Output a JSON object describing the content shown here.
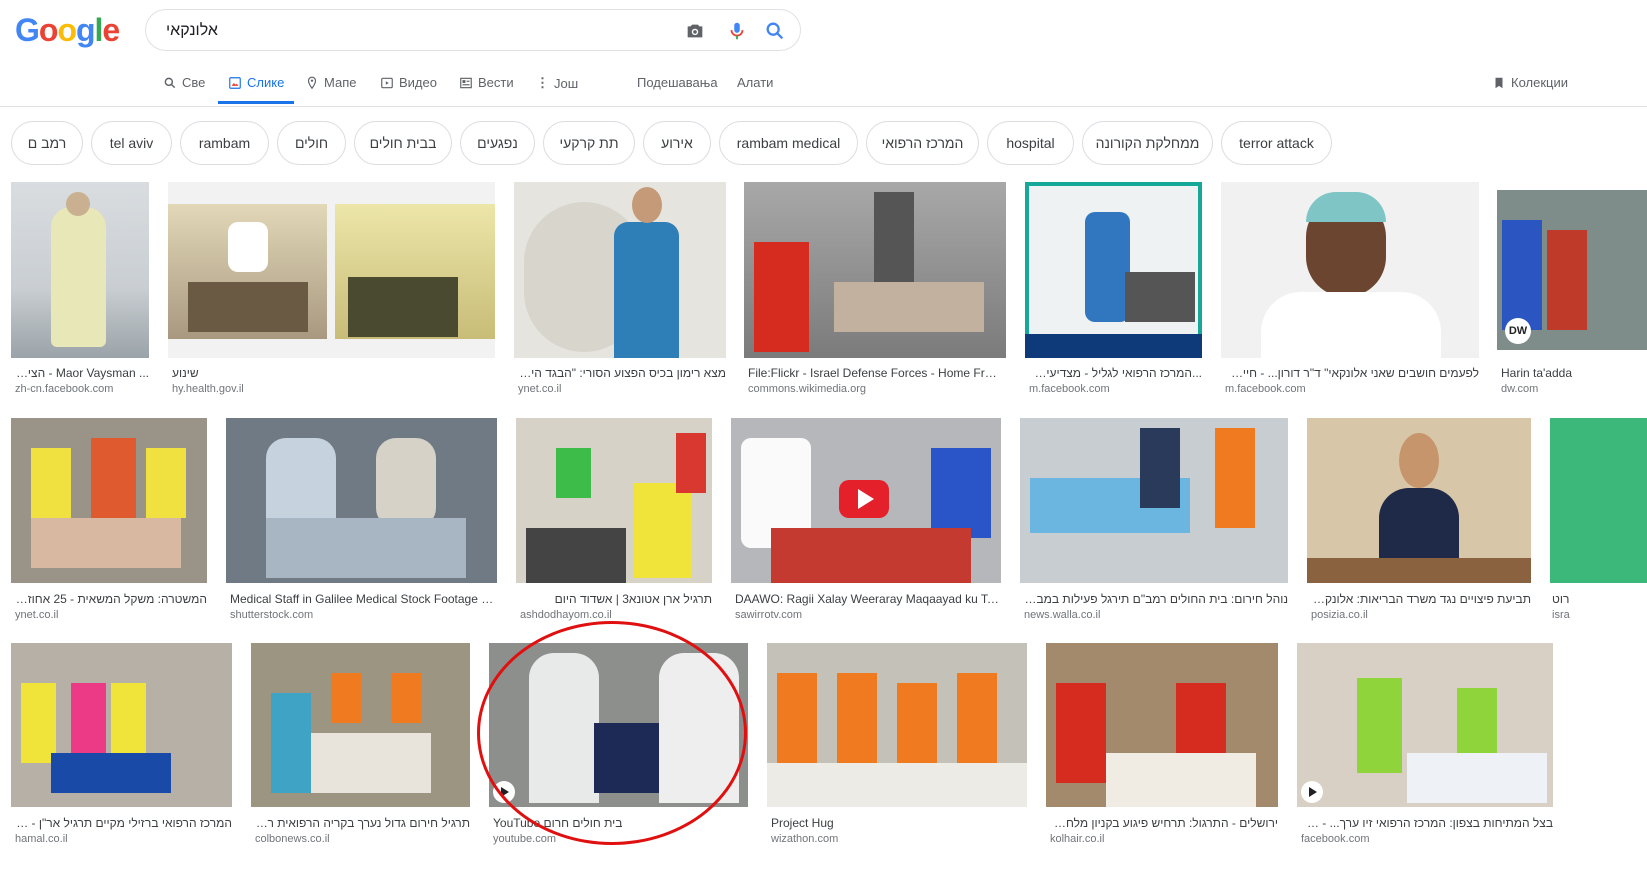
{
  "logo": {
    "letters": [
      "G",
      "o",
      "o",
      "g",
      "l",
      "e"
    ],
    "colors": [
      "#4285f4",
      "#ea4335",
      "#fbbc05",
      "#4285f4",
      "#34a853",
      "#ea4335"
    ]
  },
  "search": {
    "query": "אלונקאי"
  },
  "tabs": [
    {
      "label": "Све",
      "icon": "search-icon"
    },
    {
      "label": "Слике",
      "icon": "image-icon",
      "active": true
    },
    {
      "label": "Мапе",
      "icon": "pin-icon"
    },
    {
      "label": "Видео",
      "icon": "video-icon"
    },
    {
      "label": "Вести",
      "icon": "news-icon"
    },
    {
      "label": "Још",
      "icon": "more-icon"
    },
    {
      "label": "Подешавања"
    },
    {
      "label": "Алати"
    }
  ],
  "collections": {
    "label": "Колекции"
  },
  "chips": [
    "רמב ם",
    "tel aviv",
    "rambam",
    "חולים",
    "בבית חולים",
    "נפגעים",
    "תת קרקעי",
    "אירוע",
    "rambam medical",
    "המרכז הרפואי",
    "hospital",
    "ממחלקת הקורונה",
    "terror attack"
  ],
  "results": [
    {
      "caption": "... Maor Vaysman - הציבור",
      "source": "zh-cn.facebook.com"
    },
    {
      "caption": "שינוע",
      "source": "hy.health.gov.il"
    },
    {
      "caption": "מצא רימון בכיס הפצוע הסורי: \"הבגד היה כ",
      "source": "ynet.co.il"
    },
    {
      "caption": "File:Flickr - Israel Defense Forces - Home Front...",
      "source": "commons.wikimedia.org"
    },
    {
      "caption": "...המרכז הרפואי לגליל - מצדיעים לצוו",
      "source": "m.facebook.com"
    },
    {
      "caption": "לפעמים חושבים שאני אלונקאי\" ד\"ר דורון... - חיים של",
      "source": "m.facebook.com"
    },
    {
      "caption": "Harin ta'adda",
      "source": "dw.com"
    },
    {
      "caption": "המשטרה: משקל המשאית - 25 אחוז מ...",
      "source": "ynet.co.il"
    },
    {
      "caption": "Medical Staff in Galilee Medical Stock Footage V...",
      "source": "shutterstock.com"
    },
    {
      "caption": "תרגיל ארן אטונא3 | אשדוד היום",
      "source": "ashdodhayom.co.il"
    },
    {
      "caption": "DAAWO: Ragii Xalay Weeraray Maqaayad ku Taal...",
      "source": "sawirrotv.com"
    },
    {
      "caption": "נוהל חירום: בית החולים רמב\"ם תירגל פעילות במבנה ת...",
      "source": "news.walla.co.il"
    },
    {
      "caption": "תביעת פיצויים נגד משרד הבריאות: אלונקאי ק...",
      "source": "posizia.co.il"
    },
    {
      "caption": "רוט",
      "source": "isra"
    },
    {
      "caption": "המרכז הרפואי ברזילי מקיים תרגיל אר\"ן - תרג...",
      "source": "hamal.co.il"
    },
    {
      "caption": "תרגיל חירום גדול נערך בקריה הרפואית רמב...",
      "source": "colbonews.co.il"
    },
    {
      "caption": "YouTube בית חולים חרום",
      "source": "youtube.com"
    },
    {
      "caption": "Project Hug",
      "source": "wizathon.com"
    },
    {
      "caption": "ירושלים - התרגול: תרחיש פיגוע בקניון מלחה | כ...",
      "source": "kolhair.co.il"
    },
    {
      "caption": "בצל המתיחות בצפון: המרכז הרפואי זיו ערך... - המר...",
      "source": "facebook.com"
    }
  ],
  "colors": {
    "accent": "#1a73e8",
    "highlight_circle": "#e01010"
  }
}
